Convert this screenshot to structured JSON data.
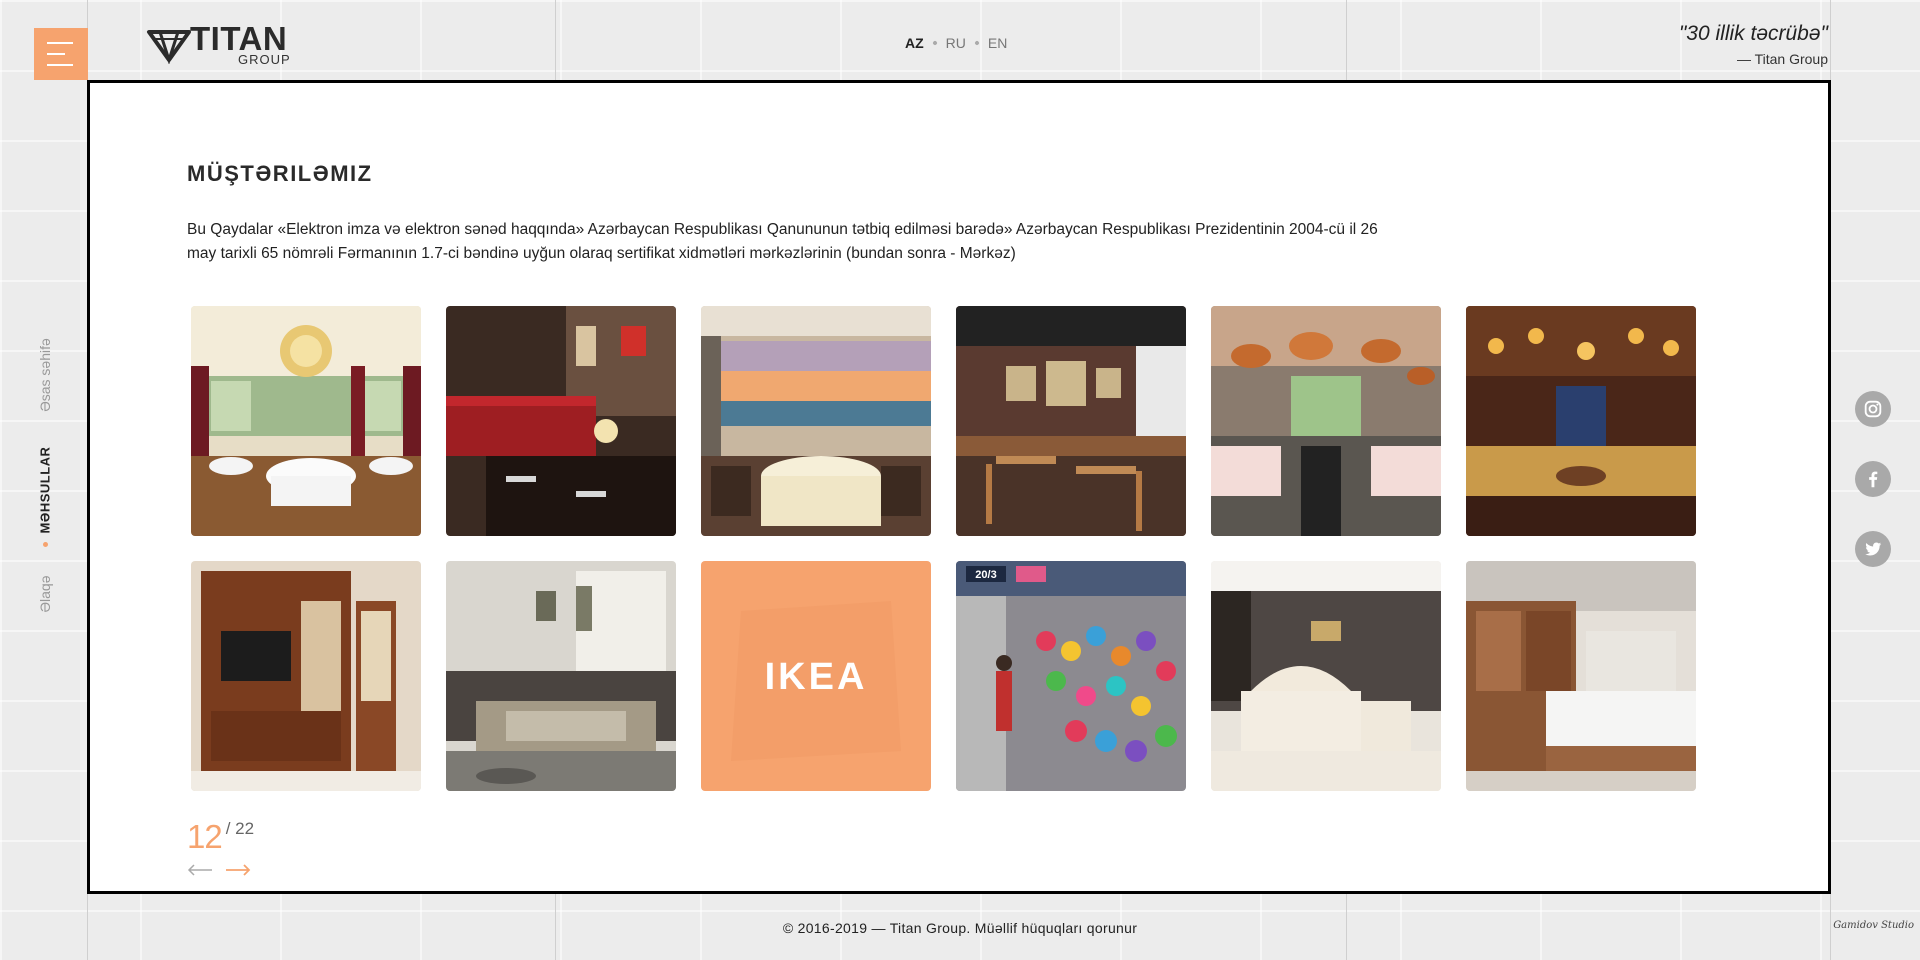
{
  "header": {
    "logo": {
      "name": "TITAN",
      "sub": "GROUP"
    },
    "languages": [
      {
        "code": "AZ",
        "active": true
      },
      {
        "code": "RU",
        "active": false
      },
      {
        "code": "EN",
        "active": false
      }
    ],
    "quote": {
      "text": "\"30 illik təcrübə\"",
      "author": "— Titan Group"
    }
  },
  "sidenav": {
    "items": [
      {
        "label": "Əsas səhifə",
        "active": false
      },
      {
        "label": "Məhsullar",
        "active": true
      },
      {
        "label": "Əlaqə",
        "active": false
      }
    ]
  },
  "social": [
    {
      "icon": "instagram-icon"
    },
    {
      "icon": "facebook-icon"
    },
    {
      "icon": "twitter-icon"
    }
  ],
  "main": {
    "title": "MÜŞTƏRILƏMIZ",
    "description": "Bu Qaydalar «Elektron imza və elektron sənəd haqqında» Azərbaycan Respublikası Qanununun tətbiq edilməsi barədə» Azərbaycan Respublikası Prezidentinin 2004-cü il 26 may tarixli 65 nömrəli Fərmanının 1.7-ci bəndinə uyğun olaraq sertifikat xidmətləri mərkəzlərinin (bundan sonra - Mərkəz)",
    "gallery": [
      {
        "subject": "classic restaurant with chandelier"
      },
      {
        "subject": "restaurant booths with red seats"
      },
      {
        "subject": "seaside restaurant at sunset"
      },
      {
        "subject": "bistro with framed pictures"
      },
      {
        "subject": "restaurant with copper pendant lamps"
      },
      {
        "subject": "luxury restaurant with golden booths"
      },
      {
        "subject": "wooden tv cabinet"
      },
      {
        "subject": "grey corner sofa bed"
      },
      {
        "subject": "ikea logo",
        "text": "IKEA"
      },
      {
        "subject": "market stall with colorful lanterns",
        "text": "20/3"
      },
      {
        "subject": "white classic bedroom set"
      },
      {
        "subject": "wooden wardrobe and bed"
      }
    ],
    "pagination": {
      "current": "12",
      "total": "/ 22"
    }
  },
  "footer": {
    "copyright": "© 2016-2019 — Titan Group. Müəllif hüquqları qorunur",
    "studio": "Gamidov Studio"
  },
  "colors": {
    "accent": "#f6a36e",
    "frame": "#000000",
    "background": "#ececec"
  }
}
